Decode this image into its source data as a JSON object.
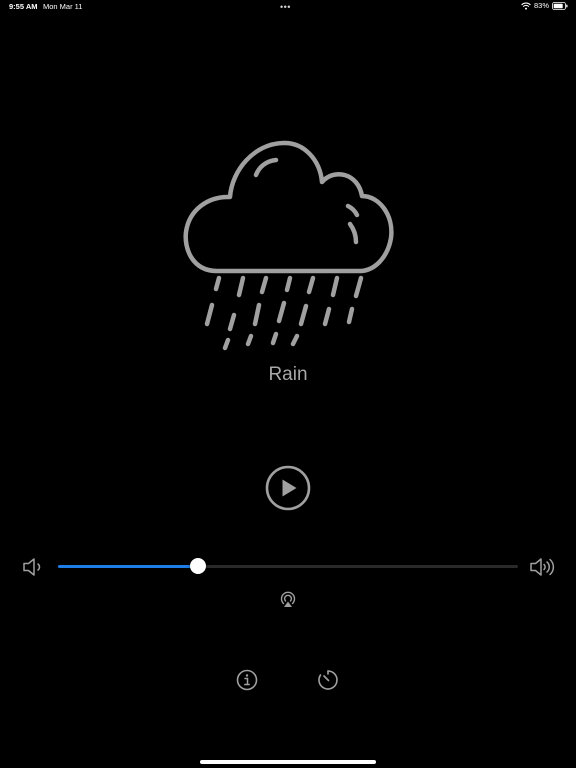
{
  "status_bar": {
    "time": "9:55 AM",
    "date": "Mon Mar 11",
    "multitask_dots": "•••",
    "battery_percent": "83%",
    "wifi_icon": "wifi-icon",
    "battery_icon": "battery-icon"
  },
  "sound": {
    "name": "Rain",
    "icon": "rain-cloud-icon"
  },
  "player": {
    "play_icon": "play-circle-icon",
    "volume_level": 0.304,
    "volume_low_icon": "speaker-low-icon",
    "volume_high_icon": "speaker-high-icon",
    "airplay_icon": "airplay-icon"
  },
  "footer": {
    "info_icon": "info-icon",
    "timer_icon": "timer-icon"
  },
  "colors": {
    "background": "#000000",
    "icon_gray": "#a0a0a0",
    "accent": "#1f7de6",
    "track": "#2a2a2a"
  }
}
